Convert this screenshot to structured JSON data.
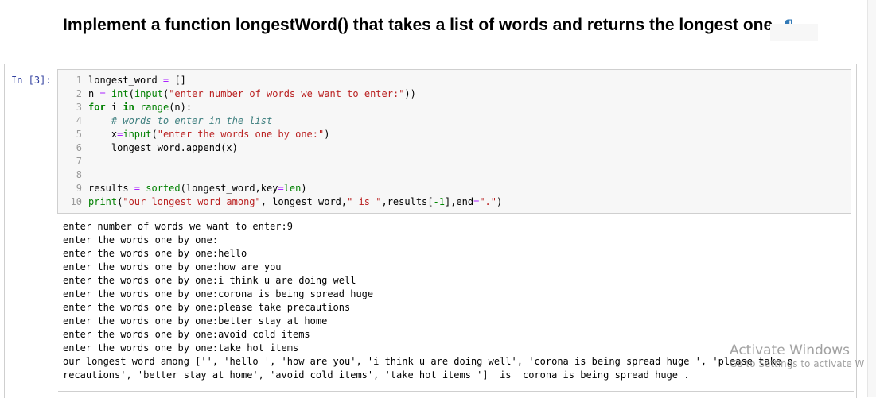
{
  "markdown": {
    "heading": "Implement a function longestWord() that takes a list of words and returns the longest one",
    "pilcrow": "¶"
  },
  "cell": {
    "prompt": "In [3]:",
    "line_numbers": [
      "1",
      "2",
      "3",
      "4",
      "5",
      "6",
      "7",
      "8",
      "9",
      "10"
    ],
    "code": {
      "l1": {
        "a": "longest_word ",
        "b": "=",
        "c": " []"
      },
      "l2": {
        "a": "n ",
        "b": "=",
        "c": " ",
        "d": "int",
        "e": "(",
        "f": "input",
        "g": "(",
        "h": "\"enter number of words we want to enter:\"",
        "i": "))"
      },
      "l3": {
        "a": "for",
        "b": " i ",
        "c": "in",
        "d": " ",
        "e": "range",
        "f": "(n):"
      },
      "l4": {
        "a": "    ",
        "b": "# words to enter in the list"
      },
      "l5": {
        "a": "    x",
        "b": "=",
        "c": "input",
        "d": "(",
        "e": "\"enter the words one by one:\"",
        "f": ")"
      },
      "l6": {
        "a": "    longest_word.append(x)"
      },
      "l9": {
        "a": "results ",
        "b": "=",
        "c": " ",
        "d": "sorted",
        "e": "(longest_word,key",
        "f": "=",
        "g": "len",
        "h": ")"
      },
      "l10": {
        "a": "print",
        "b": "(",
        "c": "\"our longest word among\"",
        "d": ", longest_word,",
        "e": "\" is \"",
        "f": ",results[",
        "g": "-1",
        "h": "],end",
        "i": "=",
        "j": "\".\"",
        "k": ")"
      }
    }
  },
  "output": {
    "lines": [
      "enter number of words we want to enter:9",
      "enter the words one by one:",
      "enter the words one by one:hello",
      "enter the words one by one:how are you",
      "enter the words one by one:i think u are doing well",
      "enter the words one by one:corona is being spread huge",
      "enter the words one by one:please take precautions",
      "enter the words one by one:better stay at home",
      "enter the words one by one:avoid cold items",
      "enter the words one by one:take hot items",
      "our longest word among ['', 'hello ', 'how are you', 'i think u are doing well', 'corona is being spread huge ', 'please take p",
      "recautions', 'better stay at home', 'avoid cold items', 'take hot items ']  is  corona is being spread huge ."
    ]
  },
  "watermark": {
    "title": "Activate Windows",
    "subtitle": "Go to Settings to activate W"
  }
}
